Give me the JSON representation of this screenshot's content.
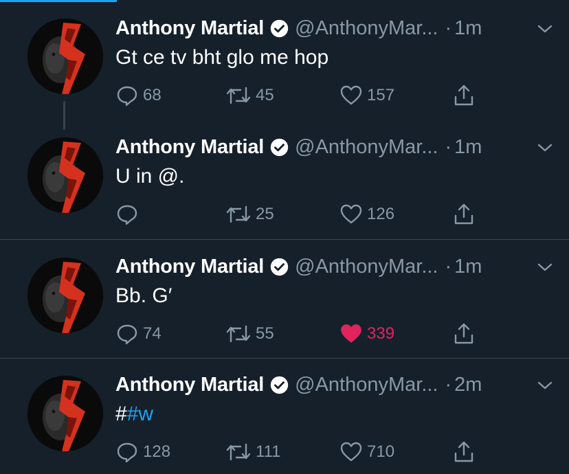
{
  "tweets": [
    {
      "display_name": "Anthony Martial",
      "handle": "@AnthonyMar...",
      "separator": "·",
      "time": "1m",
      "text": "Gt ce tv bht glo me hop",
      "replies": "68",
      "retweets": "45",
      "likes": "157"
    },
    {
      "display_name": "Anthony Martial",
      "handle": "@AnthonyMar...",
      "separator": "·",
      "time": "1m",
      "text": "U in @.",
      "replies": "",
      "retweets": "25",
      "likes": "126"
    },
    {
      "display_name": "Anthony Martial",
      "handle": "@AnthonyMar...",
      "separator": "·",
      "time": "1m",
      "text": "Bb. G′",
      "replies": "74",
      "retweets": "55",
      "likes": "339",
      "liked": true
    },
    {
      "display_name": "Anthony Martial",
      "handle": "@AnthonyMar...",
      "separator": "·",
      "time": "2m",
      "text_prefix": "#",
      "text_hashtag": "#w",
      "replies": "128",
      "retweets": "111",
      "likes": "710"
    }
  ],
  "icons": {
    "reply": "reply-icon",
    "retweet": "retweet-icon",
    "like": "heart-icon",
    "share": "share-icon",
    "verified": "verified-badge-icon",
    "more": "chevron-down-icon"
  },
  "colors": {
    "background": "#15202b",
    "text": "#ffffff",
    "muted": "#8899a6",
    "link": "#1da1f2",
    "like_active": "#e0245e",
    "divider": "#38444d"
  }
}
